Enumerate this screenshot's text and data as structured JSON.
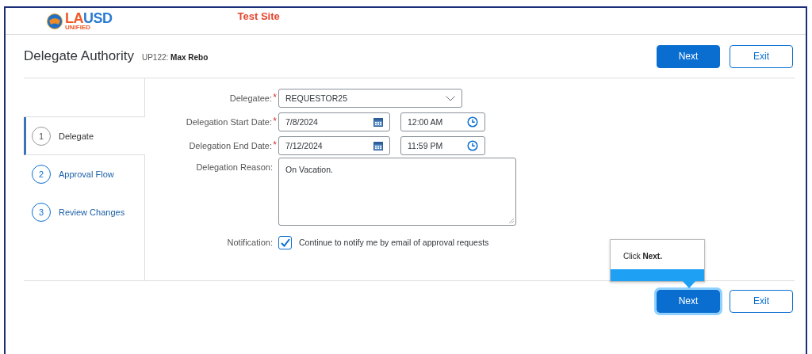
{
  "header": {
    "logo": {
      "accent": "LA",
      "rest": "USD",
      "subtitle": "UNIFIED"
    },
    "site_label": "Test Site"
  },
  "title_bar": {
    "title": "Delegate Authority",
    "user_code": "UP122:",
    "user_name": "Max Rebo",
    "buttons": [
      {
        "label": "Next",
        "kind": "primary",
        "highlighted": false
      },
      {
        "label": "Exit",
        "kind": "secondary",
        "highlighted": false
      }
    ]
  },
  "steps": [
    {
      "number": "1",
      "label": "Delegate",
      "selected": true
    },
    {
      "number": "2",
      "label": "Approval Flow",
      "selected": false
    },
    {
      "number": "3",
      "label": "Review Changes",
      "selected": false
    }
  ],
  "form": [
    {
      "kind": "select",
      "label": "Delegatee:",
      "required_mark": "*",
      "value": "REQUESTOR25"
    },
    {
      "kind": "datetime",
      "label": "Delegation Start Date:",
      "required_mark": "*",
      "date": "7/8/2024",
      "time": "12:00 AM"
    },
    {
      "kind": "datetime",
      "label": "Delegation End Date:",
      "required_mark": "*",
      "date": "7/12/2024",
      "time": "11:59 PM"
    },
    {
      "kind": "textarea",
      "label": "Delegation Reason:",
      "value": "On Vacation."
    },
    {
      "kind": "checkbox",
      "label": "Notification:",
      "checked": true,
      "text": "Continue to notify me by email of approval requests"
    }
  ],
  "tooltip": {
    "text": "Click **Next.**"
  },
  "footer_buttons": [
    {
      "label": "Next",
      "kind": "primary",
      "highlighted": true
    },
    {
      "label": "Exit",
      "kind": "secondary",
      "highlighted": false
    }
  ]
}
